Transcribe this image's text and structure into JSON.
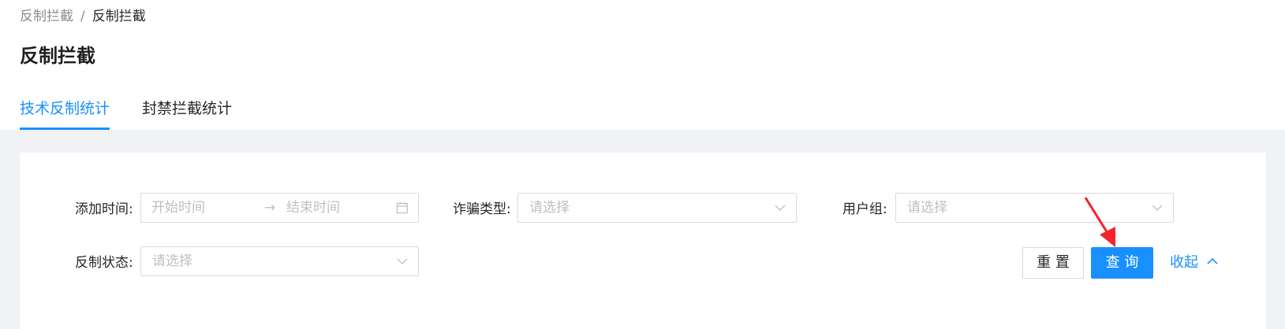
{
  "breadcrumb": {
    "parent": "反制拦截",
    "separator": "/",
    "current": "反制拦截"
  },
  "page_title": "反制拦截",
  "tabs": [
    {
      "label": "技术反制统计",
      "active": true
    },
    {
      "label": "封禁拦截统计",
      "active": false
    }
  ],
  "filters": {
    "add_time": {
      "label": "添加时间:",
      "start_placeholder": "开始时间",
      "end_placeholder": "结束时间",
      "range_separator": "→"
    },
    "fraud_type": {
      "label": "诈骗类型:",
      "placeholder": "请选择"
    },
    "user_group": {
      "label": "用户组:",
      "placeholder": "请选择"
    },
    "counter_status": {
      "label": "反制状态:",
      "placeholder": "请选择"
    }
  },
  "actions": {
    "reset_label": "重 置",
    "query_label": "查 询",
    "collapse_label": "收起"
  },
  "colors": {
    "primary": "#1890ff",
    "annotation_arrow": "#f5222d"
  }
}
